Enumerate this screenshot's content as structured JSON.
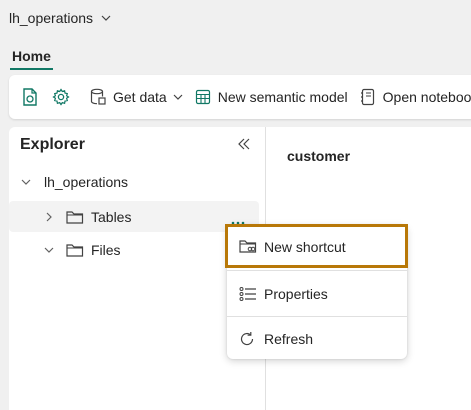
{
  "workspace": {
    "name": "lh_operations"
  },
  "ribbon": {
    "tabs": [
      {
        "label": "Home",
        "active": true
      }
    ]
  },
  "toolbar": {
    "get_data_label": "Get data",
    "new_semantic_model_label": "New semantic model",
    "open_notebook_label": "Open notebook"
  },
  "explorer": {
    "title": "Explorer",
    "root": {
      "label": "lh_operations",
      "expanded": true
    },
    "items": [
      {
        "label": "Tables",
        "expanded": false,
        "selected": true
      },
      {
        "label": "Files",
        "expanded": true,
        "selected": false
      }
    ]
  },
  "main": {
    "title": "customer"
  },
  "context_menu": {
    "items": [
      {
        "label": "New shortcut",
        "icon": "folder-link-icon",
        "highlighted": true
      },
      {
        "label": "Properties",
        "icon": "list-icon"
      },
      {
        "label": "Refresh",
        "icon": "refresh-icon"
      }
    ]
  },
  "colors": {
    "accent": "#117865",
    "highlight_border": "#b87808"
  }
}
